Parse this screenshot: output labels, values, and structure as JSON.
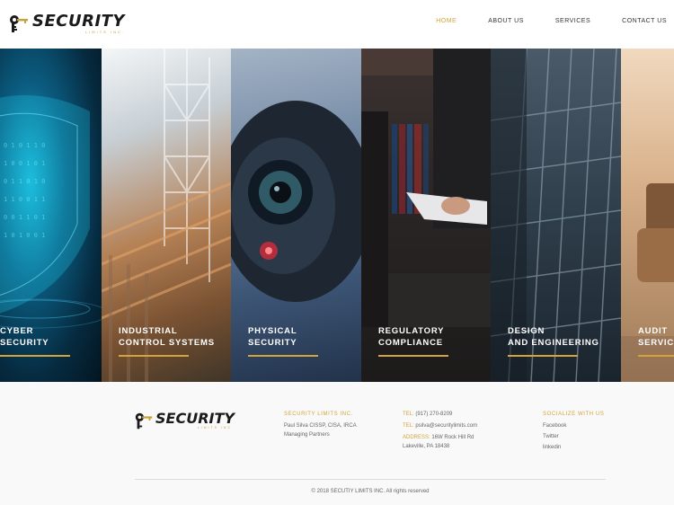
{
  "brand": {
    "name": "SECURITY",
    "tagline": "LIMITS INC."
  },
  "nav": {
    "items": [
      {
        "label": "HOME",
        "active": true
      },
      {
        "label": "ABOUT US",
        "active": false
      },
      {
        "label": "SERVICES",
        "active": false
      },
      {
        "label": "CONTACT US",
        "active": false
      }
    ]
  },
  "services": [
    {
      "line1": "CYBER",
      "line2": "SECURITY"
    },
    {
      "line1": "INDUSTRIAL",
      "line2": "CONTROL SYSTEMS"
    },
    {
      "line1": "PHYSICAL",
      "line2": "SECURITY"
    },
    {
      "line1": "REGULATORY",
      "line2": "COMPLIANCE"
    },
    {
      "line1": "DESIGN",
      "line2": "AND ENGINEERING"
    },
    {
      "line1": "AUDIT",
      "line2": "SERVICES"
    }
  ],
  "footer": {
    "company_title": "SECURITY LIMITS INC.",
    "contact_person": "Paul Silva CISSP, CISA, IRCA",
    "contact_role": "Managing Partners",
    "tel_label": "TEL:",
    "tel_value": "(917) 270-8209",
    "email_label": "TEL:",
    "email_value": "psilva@securitylimits.com",
    "address_label": "ADDRESS:",
    "address_line1": "16W Rock Hill Rd",
    "address_line2": "Lakeville, PA 18438",
    "social_title": "SOCIALIZE WITH US",
    "social": [
      "Facebook",
      "Twitter",
      "linkedin"
    ],
    "copyright": "© 2018 SECUTIY LIMITS INC. All rights reserved"
  },
  "colors": {
    "accent": "#d4a43a",
    "text_dark": "#1a1a1a",
    "footer_bg": "#f9f9f9"
  }
}
